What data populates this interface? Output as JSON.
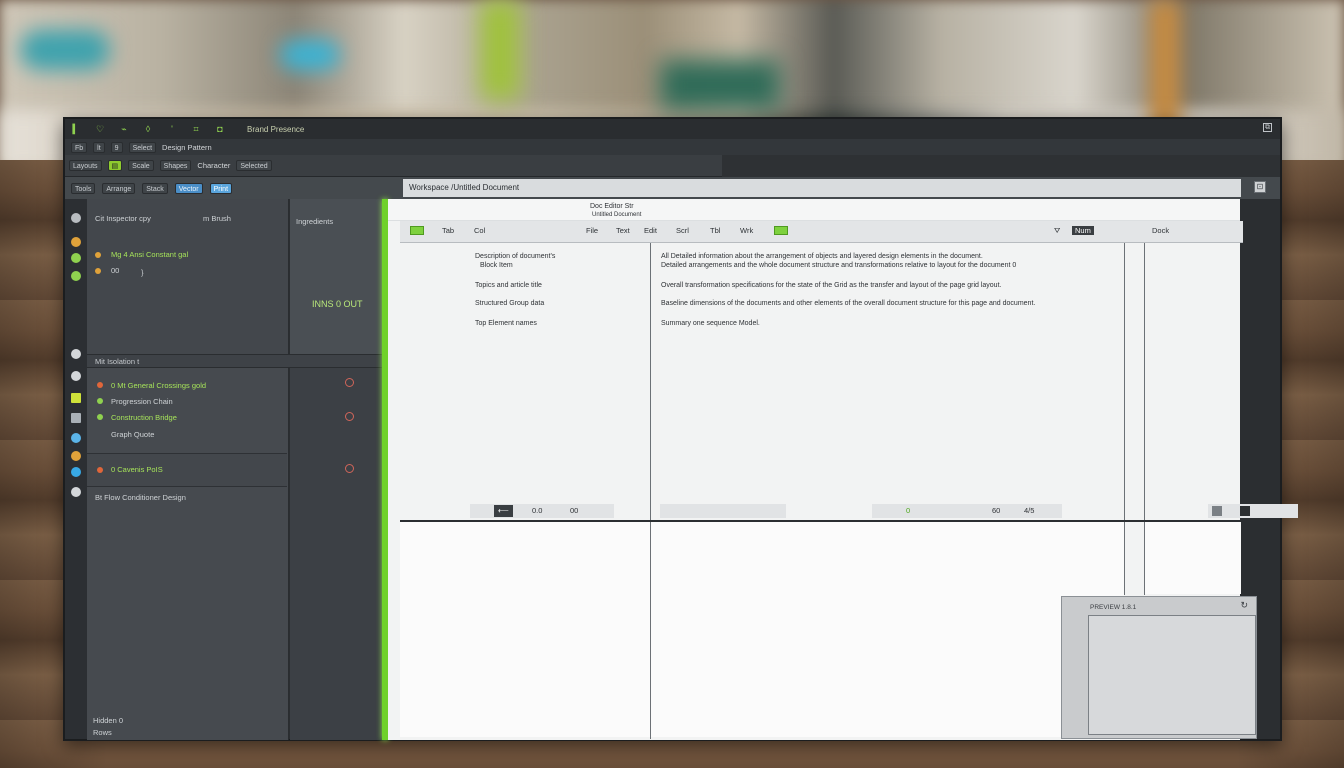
{
  "titlebar": {
    "icons": [
      "app-icon",
      "heart-icon",
      "link-icon",
      "shield-icon",
      "pin-icon",
      "ruler-icon",
      "chat-icon"
    ],
    "title": "Brand Presence",
    "corner_icon": "restore-icon"
  },
  "toolbar1": {
    "items": [
      "Fb",
      "lt",
      "9",
      "Select"
    ],
    "label": "Design Pattern"
  },
  "toolbar2": {
    "items": [
      "Layouts",
      "Scale",
      "Shapes",
      "Character",
      "Selected"
    ]
  },
  "toolbar3": {
    "items": [
      "Tools",
      "Arrange",
      "Stack",
      "Vector",
      "Print"
    ],
    "breadcrumb": "Workspace /Untitled Document",
    "corner": "⊡"
  },
  "panelA": {
    "header_left": "Cit  Inspector  cpy",
    "header_right": "m  Brush",
    "line1": "Mg 4  Ansi Constant gal",
    "line2": "00",
    "line3": "}"
  },
  "panelB": {
    "label": "Ingredients",
    "big": "INNS 0 OUT"
  },
  "panelC": {
    "header": "Mit  Isolation   t",
    "row1": "0  Mt  General Crossings gold",
    "row2": "Progression Chain",
    "row3": "Construction Bridge",
    "row4": "Graph Quote",
    "row5": "0  Cavenis PoIS",
    "row6": "Bt   Flow Conditioner Design",
    "footer1": "Hidden 0",
    "footer2": "Rows"
  },
  "doc": {
    "top_label1": "Doc  Editor Str",
    "top_label2": "Untitled Document",
    "tabs": [
      "Tab",
      "Col",
      "File",
      "Text",
      "Edit",
      "Scrl",
      "Tbl",
      "Wrk",
      "Num"
    ],
    "right_tab": "Dock",
    "left_col": [
      "Description of document's",
      "Block Item",
      "Topics and article title",
      "Structured Group data",
      "Top Element names"
    ],
    "mid_col": [
      "All  Detailed information about the arrangement of objects and layered design elements in the document.",
      "Detailed arrangements and the whole document structure and transformations relative to layout for the document 0",
      "Overall transformation specifications for the state of the Grid as the transfer and layout of the page grid layout.",
      "Baseline dimensions of the documents and other elements of the overall document structure for this page and document.",
      "Summary one sequence Model."
    ],
    "status_left": [
      "⟵",
      "0.0",
      "00"
    ],
    "status_mid": [
      "0",
      "60",
      "4/5"
    ],
    "preview_label": "PREVIEW 1.8.1"
  },
  "colors": {
    "accent": "#6fd12a",
    "panel": "#43474c",
    "doc": "#f2f3f3"
  }
}
